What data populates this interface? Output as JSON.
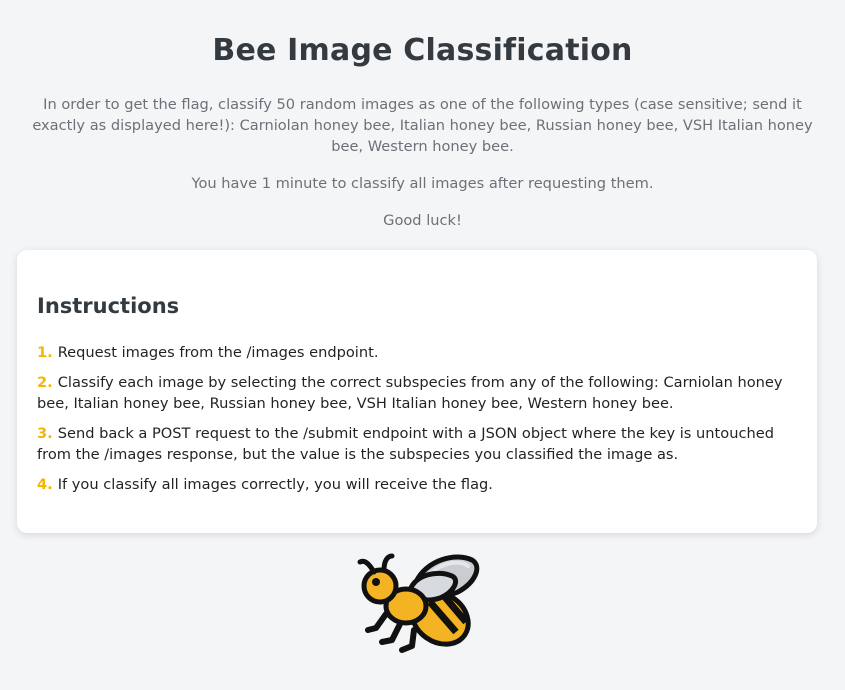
{
  "page": {
    "title": "Bee Image Classification",
    "intro_paragraph": "In order to get the flag, classify 50 random images as one of the following types (case sensitive; send it exactly as displayed here!): Carniolan honey bee, Italian honey bee, Russian honey bee, VSH Italian honey bee, Western honey bee.",
    "time_limit": "You have 1 minute to classify all images after requesting them.",
    "good_luck": "Good luck!"
  },
  "instructions": {
    "heading": "Instructions",
    "steps": [
      {
        "number": "1.",
        "text": "Request images from the /images endpoint."
      },
      {
        "number": "2.",
        "text": "Classify each image by selecting the correct subspecies from any of the following: Carniolan honey bee, Italian honey bee, Russian honey bee, VSH Italian honey bee, Western honey bee."
      },
      {
        "number": "3.",
        "text": "Send back a POST request to the /submit endpoint with a JSON object where the key is untouched from the /images response, but the value is the subspecies you classified the image as."
      },
      {
        "number": "4.",
        "text": "If you classify all images correctly, you will receive the flag."
      }
    ]
  },
  "colors": {
    "background": "#f4f5f7",
    "step_number_accent": "#f2b705",
    "heading_text": "#333a40",
    "muted_text": "#6b7178"
  },
  "icons": {
    "footer": "honeybee-icon"
  }
}
